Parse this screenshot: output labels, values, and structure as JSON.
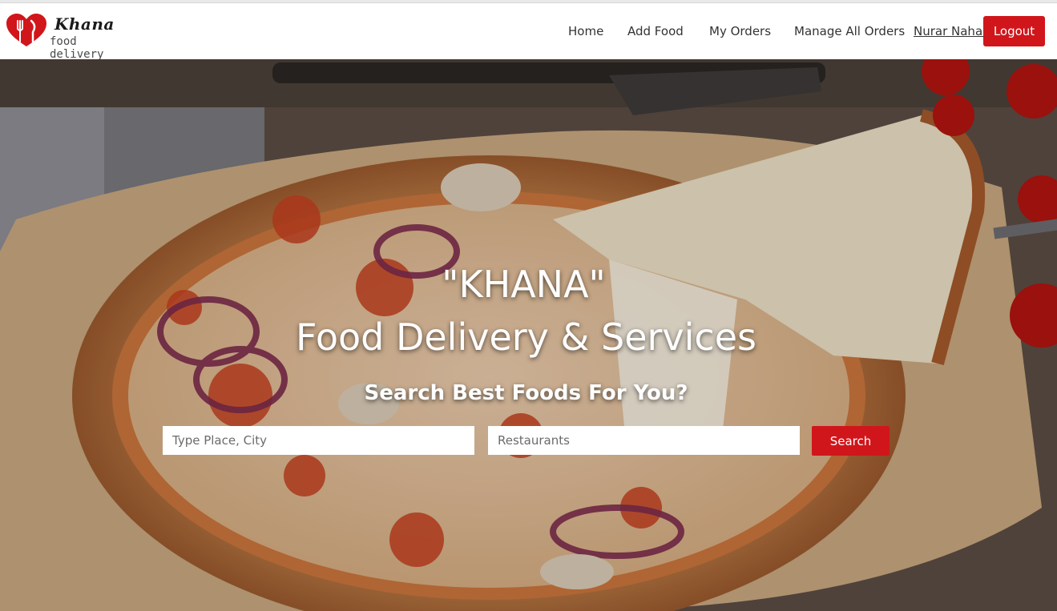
{
  "brand": {
    "name": "Khana",
    "tagline": "food delivery",
    "color": "#d0161b"
  },
  "nav": {
    "home": "Home",
    "add_food": "Add Food",
    "my_orders": "My Orders",
    "manage_orders": "Manage All Orders",
    "user": "Nurar Nahar",
    "logout": "Logout"
  },
  "hero": {
    "title_line1": "\"KHANA\"",
    "title_line2": "Food Delivery & Services",
    "subtitle": "Search Best Foods For You?",
    "place_placeholder": "Type Place, City",
    "restaurant_placeholder": "Restaurants",
    "search_label": "Search",
    "background": "pizza-photo"
  },
  "colors": {
    "accent": "#d0161b",
    "nav_text": "#333333"
  }
}
